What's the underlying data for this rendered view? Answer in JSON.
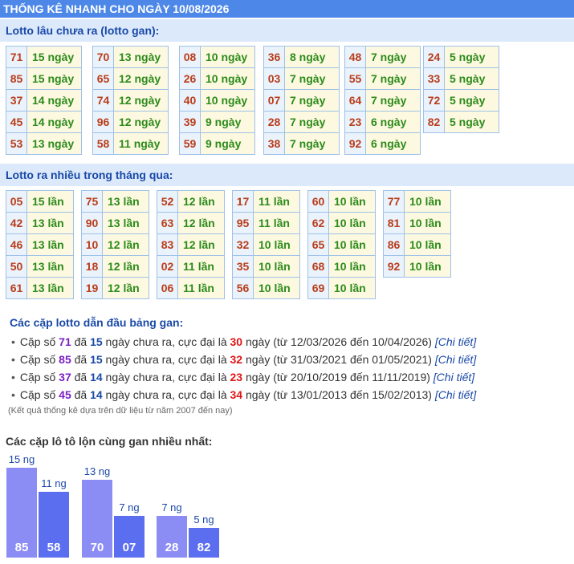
{
  "header": {
    "title": "THỐNG KÊ NHANH CHO NGÀY 10/08/2026"
  },
  "gan_section": {
    "title": "Lotto lâu chưa ra (lotto gan):",
    "groups": [
      [
        {
          "num": "71",
          "val": "15 ngày"
        },
        {
          "num": "85",
          "val": "15 ngày"
        },
        {
          "num": "37",
          "val": "14 ngày"
        },
        {
          "num": "45",
          "val": "14 ngày"
        },
        {
          "num": "53",
          "val": "13 ngày"
        }
      ],
      [
        {
          "num": "70",
          "val": "13 ngày"
        },
        {
          "num": "65",
          "val": "12 ngày"
        },
        {
          "num": "74",
          "val": "12 ngày"
        },
        {
          "num": "96",
          "val": "12 ngày"
        },
        {
          "num": "58",
          "val": "11 ngày"
        }
      ],
      [
        {
          "num": "08",
          "val": "10 ngày"
        },
        {
          "num": "26",
          "val": "10 ngày"
        },
        {
          "num": "40",
          "val": "10 ngày"
        },
        {
          "num": "39",
          "val": "9 ngày"
        },
        {
          "num": "59",
          "val": "9 ngày"
        }
      ],
      [
        {
          "num": "36",
          "val": "8 ngày"
        },
        {
          "num": "03",
          "val": "7 ngày"
        },
        {
          "num": "07",
          "val": "7 ngày"
        },
        {
          "num": "28",
          "val": "7 ngày"
        },
        {
          "num": "38",
          "val": "7 ngày"
        }
      ],
      [
        {
          "num": "48",
          "val": "7 ngày"
        },
        {
          "num": "55",
          "val": "7 ngày"
        },
        {
          "num": "64",
          "val": "7 ngày"
        },
        {
          "num": "23",
          "val": "6 ngày"
        },
        {
          "num": "92",
          "val": "6 ngày"
        }
      ],
      [
        {
          "num": "24",
          "val": "5 ngày"
        },
        {
          "num": "33",
          "val": "5 ngày"
        },
        {
          "num": "72",
          "val": "5 ngày"
        },
        {
          "num": "82",
          "val": "5 ngày"
        }
      ]
    ]
  },
  "freq_section": {
    "title": "Lotto ra nhiều trong tháng qua:",
    "groups": [
      [
        {
          "num": "05",
          "val": "15 lần"
        },
        {
          "num": "42",
          "val": "13 lần"
        },
        {
          "num": "46",
          "val": "13 lần"
        },
        {
          "num": "50",
          "val": "13 lần"
        },
        {
          "num": "61",
          "val": "13 lần"
        }
      ],
      [
        {
          "num": "75",
          "val": "13 lần"
        },
        {
          "num": "90",
          "val": "13 lần"
        },
        {
          "num": "10",
          "val": "12 lần"
        },
        {
          "num": "18",
          "val": "12 lần"
        },
        {
          "num": "19",
          "val": "12 lần"
        }
      ],
      [
        {
          "num": "52",
          "val": "12 lần"
        },
        {
          "num": "63",
          "val": "12 lần"
        },
        {
          "num": "83",
          "val": "12 lần"
        },
        {
          "num": "02",
          "val": "11 lần"
        },
        {
          "num": "06",
          "val": "11 lần"
        }
      ],
      [
        {
          "num": "17",
          "val": "11 lần"
        },
        {
          "num": "95",
          "val": "11 lần"
        },
        {
          "num": "32",
          "val": "10 lần"
        },
        {
          "num": "35",
          "val": "10 lần"
        },
        {
          "num": "56",
          "val": "10 lần"
        }
      ],
      [
        {
          "num": "60",
          "val": "10 lần"
        },
        {
          "num": "62",
          "val": "10 lần"
        },
        {
          "num": "65",
          "val": "10 lần"
        },
        {
          "num": "68",
          "val": "10 lần"
        },
        {
          "num": "69",
          "val": "10 lần"
        }
      ],
      [
        {
          "num": "77",
          "val": "10 lần"
        },
        {
          "num": "81",
          "val": "10 lần"
        },
        {
          "num": "86",
          "val": "10 lần"
        },
        {
          "num": "92",
          "val": "10 lần"
        }
      ]
    ]
  },
  "pairs_section": {
    "title": "Các cặp lotto dẫn đầu bảng gan:",
    "prefix": "Cặp số",
    "da": "đã",
    "chua_ra": "ngày chưa ra, cực đại là",
    "ngay": "ngày",
    "link": "[Chi tiết]",
    "items": [
      {
        "num": "71",
        "cur": "15",
        "max": "30",
        "range": "(từ 12/03/2026 đến 10/04/2026)"
      },
      {
        "num": "85",
        "cur": "15",
        "max": "32",
        "range": "(từ 31/03/2021 đến 01/05/2021)"
      },
      {
        "num": "37",
        "cur": "14",
        "max": "23",
        "range": "(từ 20/10/2019 đến 11/11/2019)"
      },
      {
        "num": "45",
        "cur": "14",
        "max": "34",
        "range": "(từ 13/01/2013 đến 15/02/2013)"
      }
    ],
    "note": "(Kết quả thống kê dựa trên dữ liệu từ năm 2007 đến nay)"
  },
  "bar_chart_title": "Các cặp lô tô lộn cùng gan nhiều nhất:",
  "chart_data": {
    "type": "bar",
    "title": "Các cặp lô tô lộn cùng gan nhiều nhất:",
    "categories": [
      "85",
      "58",
      "70",
      "07",
      "28",
      "82"
    ],
    "values": [
      15,
      11,
      13,
      7,
      7,
      5
    ],
    "value_labels": [
      "15 ng",
      "11 ng",
      "13 ng",
      "7 ng",
      "7 ng",
      "5 ng"
    ],
    "pairs": [
      [
        "85",
        "58"
      ],
      [
        "70",
        "07"
      ],
      [
        "28",
        "82"
      ]
    ],
    "colors": {
      "first": "#8c8cf5",
      "second": "#5c6ef0"
    }
  }
}
